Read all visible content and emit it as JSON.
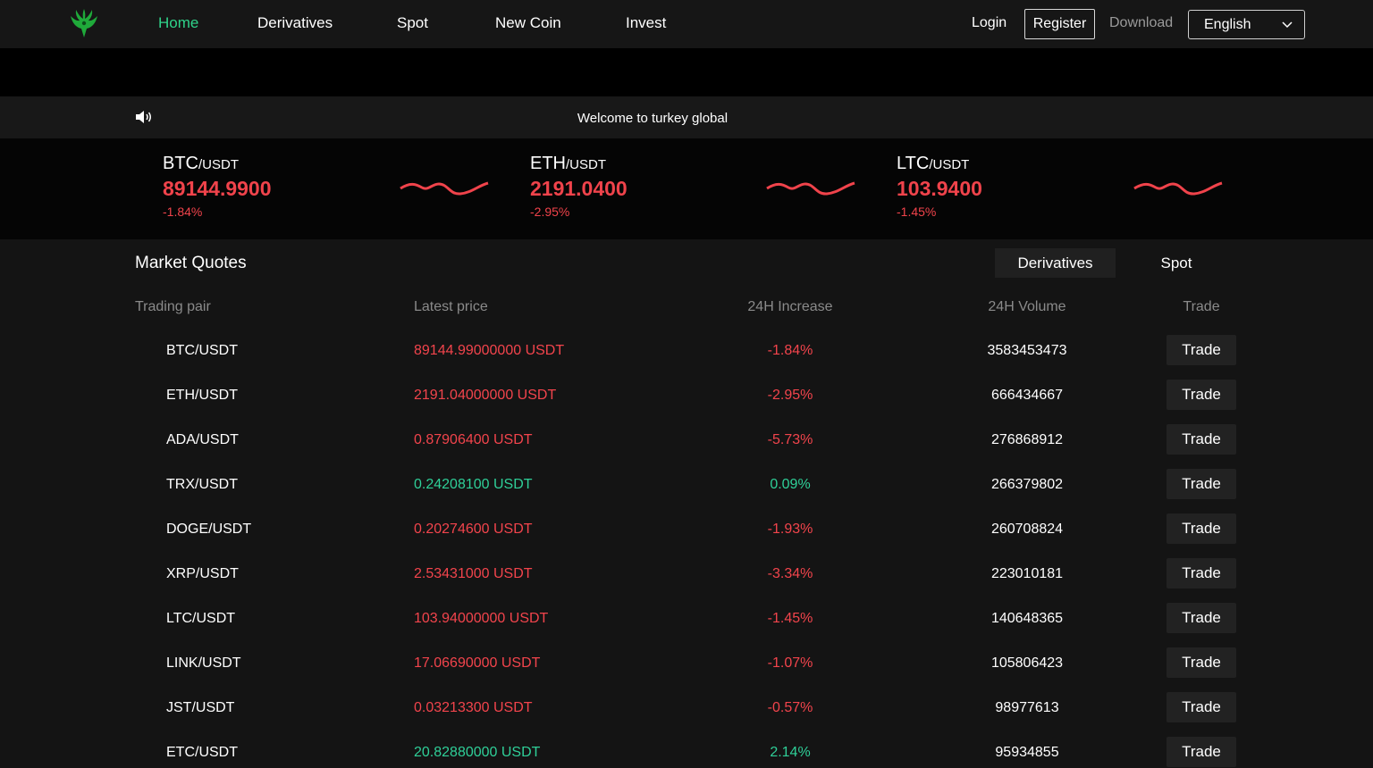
{
  "nav": {
    "items": [
      "Home",
      "Derivatives",
      "Spot",
      "New Coin",
      "Invest"
    ],
    "login": "Login",
    "register": "Register",
    "download": "Download",
    "language": "English"
  },
  "notice": {
    "text": "Welcome to turkey global"
  },
  "tickers": [
    {
      "base": "BTC",
      "quote": "/USDT",
      "price": "89144.9900",
      "change": "-1.84%"
    },
    {
      "base": "ETH",
      "quote": "/USDT",
      "price": "2191.0400",
      "change": "-2.95%"
    },
    {
      "base": "LTC",
      "quote": "/USDT",
      "price": "103.9400",
      "change": "-1.45%"
    }
  ],
  "market": {
    "title": "Market Quotes",
    "tabs": [
      "Derivatives",
      "Spot"
    ],
    "columns": [
      "Trading pair",
      "Latest price",
      "24H Increase",
      "24H Volume",
      "Trade"
    ],
    "trade_label": "Trade",
    "rows": [
      {
        "pair": "BTC/USDT",
        "price": "89144.99000000 USDT",
        "change": "-1.84%",
        "volume": "3583453473",
        "trend": "down"
      },
      {
        "pair": "ETH/USDT",
        "price": "2191.04000000 USDT",
        "change": "-2.95%",
        "volume": "666434667",
        "trend": "down"
      },
      {
        "pair": "ADA/USDT",
        "price": "0.87906400 USDT",
        "change": "-5.73%",
        "volume": "276868912",
        "trend": "down"
      },
      {
        "pair": "TRX/USDT",
        "price": "0.24208100 USDT",
        "change": "0.09%",
        "volume": "266379802",
        "trend": "up"
      },
      {
        "pair": "DOGE/USDT",
        "price": "0.20274600 USDT",
        "change": "-1.93%",
        "volume": "260708824",
        "trend": "down"
      },
      {
        "pair": "XRP/USDT",
        "price": "2.53431000 USDT",
        "change": "-3.34%",
        "volume": "223010181",
        "trend": "down"
      },
      {
        "pair": "LTC/USDT",
        "price": "103.94000000 USDT",
        "change": "-1.45%",
        "volume": "140648365",
        "trend": "down"
      },
      {
        "pair": "LINK/USDT",
        "price": "17.06690000 USDT",
        "change": "-1.07%",
        "volume": "105806423",
        "trend": "down"
      },
      {
        "pair": "JST/USDT",
        "price": "0.03213300 USDT",
        "change": "-0.57%",
        "volume": "98977613",
        "trend": "down"
      },
      {
        "pair": "ETC/USDT",
        "price": "20.82880000 USDT",
        "change": "2.14%",
        "volume": "95934855",
        "trend": "up"
      }
    ]
  },
  "colors": {
    "accent": "#2fd38a",
    "up": "#2fcf98",
    "down": "#f2444c"
  },
  "icons": {
    "logo": "phoenix-logo-icon",
    "speaker": "speaker-icon",
    "chevron": "chevron-down-icon"
  }
}
